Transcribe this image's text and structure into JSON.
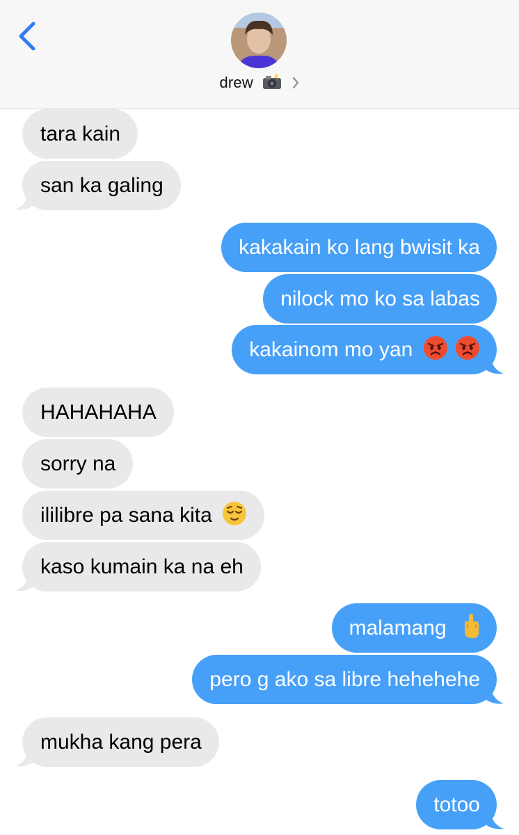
{
  "header": {
    "contact_name": "drew",
    "contact_icon": "camera-flash-emoji",
    "back_icon": "chevron-left-icon",
    "details_icon": "chevron-right-icon"
  },
  "colors": {
    "incoming_bubble": "#e9e9eb",
    "outgoing_bubble": "#47a0f8",
    "accent": "#2f7cf6"
  },
  "messages": [
    {
      "from": "drew",
      "text": "tara kain"
    },
    {
      "from": "drew",
      "text": "san ka galing"
    },
    {
      "from": "me",
      "text": "kakakain ko lang bwisit ka"
    },
    {
      "from": "me",
      "text": "nilock mo ko sa labas"
    },
    {
      "from": "me",
      "text": "kakainom mo yan",
      "emoji": [
        "angry-face",
        "angry-face"
      ]
    },
    {
      "from": "drew",
      "text": "HAHAHAHA"
    },
    {
      "from": "drew",
      "text": "sorry na"
    },
    {
      "from": "drew",
      "text": "ililibre pa sana kita",
      "emoji": [
        "relieved-face"
      ]
    },
    {
      "from": "drew",
      "text": "kaso kumain ka na eh"
    },
    {
      "from": "me",
      "text": "malamang",
      "emoji": [
        "middle-finger"
      ]
    },
    {
      "from": "me",
      "text": "pero g ako sa libre hehehehe"
    },
    {
      "from": "drew",
      "text": "mukha kang pera"
    },
    {
      "from": "me",
      "text": "totoo"
    }
  ]
}
